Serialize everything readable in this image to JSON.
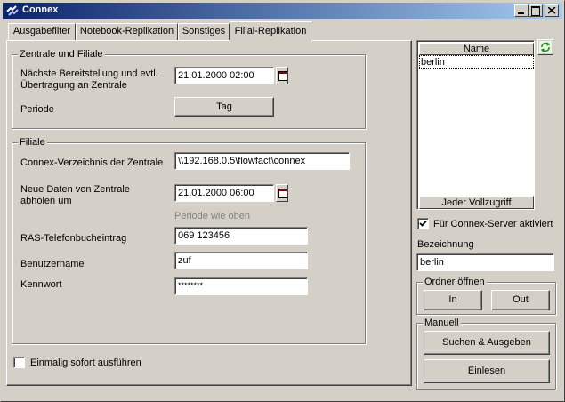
{
  "window": {
    "title": "Connex"
  },
  "tabs": [
    {
      "label": "Ausgabefilter"
    },
    {
      "label": "Notebook-Replikation"
    },
    {
      "label": "Sonstiges"
    },
    {
      "label": "Filial-Replikation"
    }
  ],
  "zentrale": {
    "group_label": "Zentrale und Filiale",
    "next_label_line1": "Nächste Bereitstellung und evtl.",
    "next_label_line2": "Übertragung an Zentrale",
    "next_value": "21.01.2000 02:00",
    "periode_label": "Periode",
    "periode_button": "Tag"
  },
  "filiale": {
    "group_label": "Filiale",
    "dir_label": "Connex-Verzeichnis der Zentrale",
    "dir_value": "\\\\192.168.0.5\\flowfact\\connex",
    "fetch_label_line1": "Neue Daten von Zentrale",
    "fetch_label_line2": "abholen um",
    "fetch_value": "21.01.2000 06:00",
    "periode_hint": "Periode wie oben",
    "ras_label": "RAS-Telefonbucheintrag",
    "ras_value": "069 123456",
    "user_label": "Benutzername",
    "user_value": "zuf",
    "password_label": "Kennwort",
    "password_value": "********"
  },
  "once": {
    "label": "Einmalig sofort ausführen",
    "checked": false
  },
  "list": {
    "header": "Name",
    "items": [
      "berlin"
    ],
    "footer": "Jeder Vollzugriff"
  },
  "server_active": {
    "label": "Für Connex-Server aktiviert",
    "checked": true
  },
  "bezeichnung": {
    "label": "Bezeichnung",
    "value": "berlin"
  },
  "ordner": {
    "group_label": "Ordner öffnen",
    "in_button": "In",
    "out_button": "Out"
  },
  "manuell": {
    "group_label": "Manuell",
    "search_button": "Suchen & Ausgeben",
    "import_button": "Einlesen"
  },
  "colors": {
    "titlebar_start": "#0a246a",
    "titlebar_end": "#a6caf0",
    "face": "#d4d0c8"
  }
}
